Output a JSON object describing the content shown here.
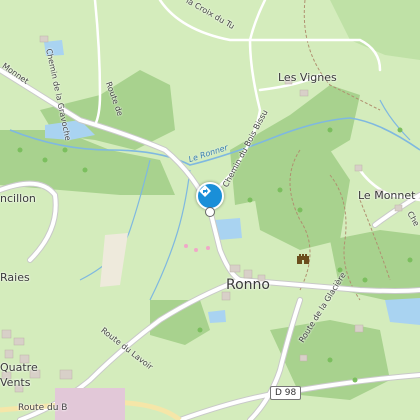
{
  "map": {
    "colors": {
      "land": "#d4ecbc",
      "forest": "#a8d28e",
      "water": "#a9d3f1",
      "road": "#ffffff",
      "road_casing": "#c9c9c9",
      "track": "#b09070",
      "building": "#d8d0c8",
      "marker": "#1a8fd8"
    },
    "labels": {
      "croix_du_tu": "la Croix du Tu",
      "chemin_graviche": "Chemin de la Gravoche",
      "les_vignes": "Les Vignes",
      "monnet": "Monnet",
      "ronner": "Le Ronner",
      "chemin_bois": "Chemin du Bois Bissu",
      "route_cote": "Route de",
      "le_monnet": "Le Monnet",
      "che": "Che",
      "ancillon": "ncillon",
      "raies": "Raies",
      "ronno": "Ronno",
      "route_lavoir": "Route du Lavoir",
      "route_glaciere": "Route de la Glacière",
      "quatre": "Quatre",
      "vents": "Vents",
      "route_du_b": "Route du B",
      "d98": "D 98"
    },
    "marker_icon": "directions-marker-icon",
    "castle_icon": "castle-icon"
  }
}
